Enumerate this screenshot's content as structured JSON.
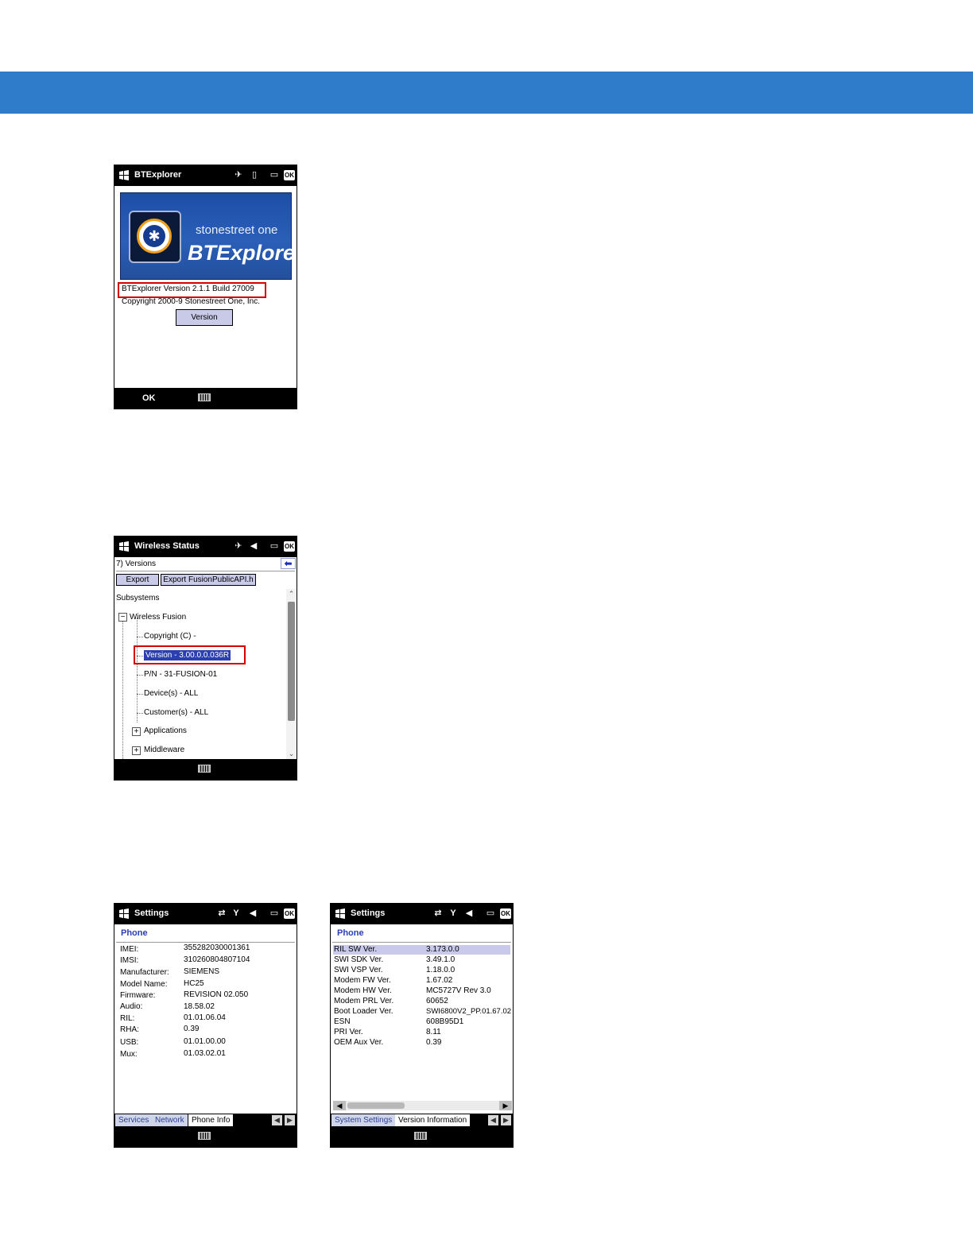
{
  "screen1": {
    "title": "BTExplorer",
    "ok_badge": "OK",
    "logo_brand": "stonestreet one",
    "logo_product": "BTExplorer",
    "version_line": "BTExplorer Version 2.1.1  Build 27009",
    "copyright_line": "Copyright 2000-9 Stonestreet One, Inc.",
    "version_button": "Version",
    "softkey_left": "OK"
  },
  "screen2": {
    "title": "Wireless Status",
    "ok_badge": "OK",
    "breadcrumb": "7) Versions",
    "export_button": "Export",
    "export_api_button": "Export FusionPublicAPI.h",
    "section_label": "Subsystems",
    "tree": {
      "root": "Wireless Fusion",
      "items": [
        "Copyright (C) -",
        "Version - 3.00.0.0.036R",
        "P/N - 31-FUSION-01",
        "Device(s) - ALL",
        "Customer(s) - ALL"
      ],
      "groups": [
        "Applications",
        "Middleware"
      ]
    }
  },
  "screen3": {
    "title": "Settings",
    "ok_badge": "OK",
    "section": "Phone",
    "rows": [
      {
        "label": "IMEI:",
        "value": "355282030001361"
      },
      {
        "label": "IMSI:",
        "value": "310260804807104"
      },
      {
        "label": "Manufacturer:",
        "value": "SIEMENS"
      },
      {
        "label": "Model Name:",
        "value": "HC25"
      },
      {
        "label": "Firmware:",
        "value": "REVISION 02.050"
      },
      {
        "label": "Audio:",
        "value": "18.58.02"
      },
      {
        "label": "RIL:",
        "value": "01.01.06.04"
      },
      {
        "label": "RHA:",
        "value": "0.39"
      },
      {
        "label": "USB:",
        "value": "01.01.00.00"
      },
      {
        "label": "Mux:",
        "value": "01.03.02.01"
      }
    ],
    "tabs": [
      "Services",
      "Network",
      "Phone Info"
    ]
  },
  "screen4": {
    "title": "Settings",
    "ok_badge": "OK",
    "section": "Phone",
    "rows": [
      {
        "label": "RIL SW Ver.",
        "value": "3.173.0.0"
      },
      {
        "label": "SWI SDK Ver.",
        "value": "3.49.1.0"
      },
      {
        "label": "SWI VSP Ver.",
        "value": "1.18.0.0"
      },
      {
        "label": "Modem FW Ver.",
        "value": "1.67.02"
      },
      {
        "label": "Modem HW Ver.",
        "value": "MC5727V Rev 3.0"
      },
      {
        "label": "Modem PRL Ver.",
        "value": "60652"
      },
      {
        "label": "Boot Loader Ver.",
        "value": "SWI6800V2_PP.01.67.02"
      },
      {
        "label": "ESN",
        "value": "608B95D1"
      },
      {
        "label": "PRI Ver.",
        "value": "8.11"
      },
      {
        "label": "OEM Aux Ver.",
        "value": "0.39"
      }
    ],
    "tabs": [
      "System Settings",
      "Version Information"
    ]
  },
  "colors": {
    "banner": "#2f7ccb",
    "highlight": "#2b3fb0",
    "callout": "#d40000"
  }
}
